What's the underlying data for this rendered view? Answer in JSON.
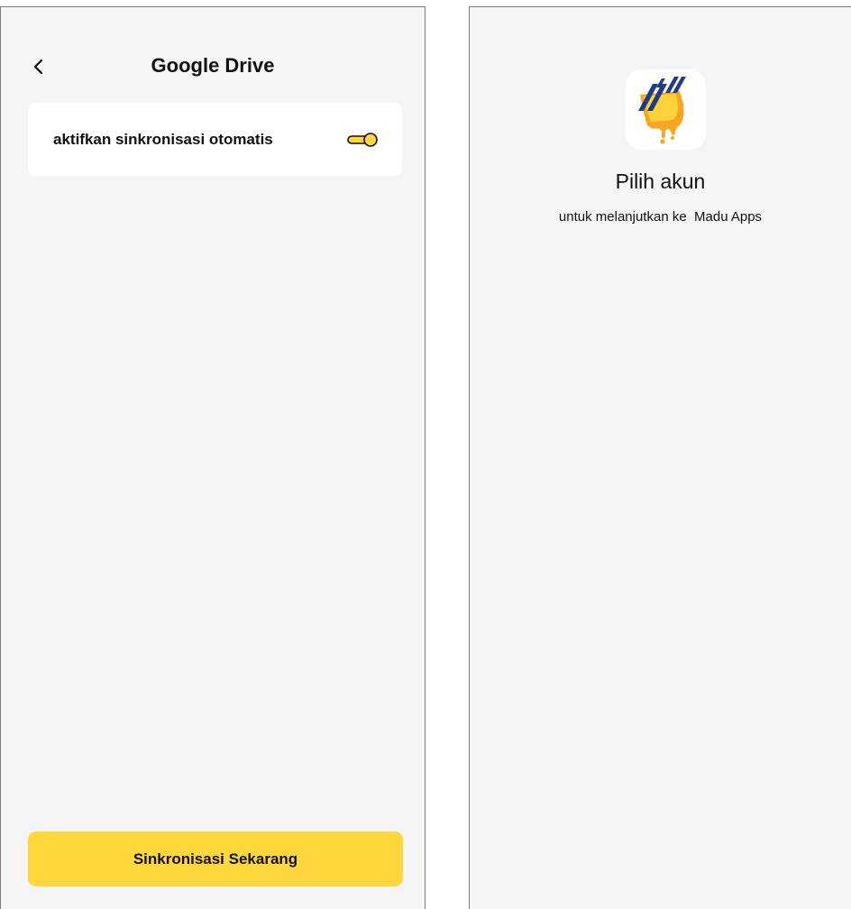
{
  "drive_screen": {
    "title": "Google Drive",
    "back_icon": "chevron-left-icon",
    "sync_option": {
      "label": "aktifkan sinkronisasi otomatis",
      "toggle_icon": "toggle-switch-icon",
      "toggle_color": "#FFD73C"
    },
    "sync_button_label": "Sinkronisasi Sekarang",
    "sync_button_color": "#FFD73C"
  },
  "account_screen": {
    "logo_icon": "madu-apps-logo-icon",
    "title": "Pilih akun",
    "subtitle": "untuk melanjutkan ke  Madu Apps"
  }
}
